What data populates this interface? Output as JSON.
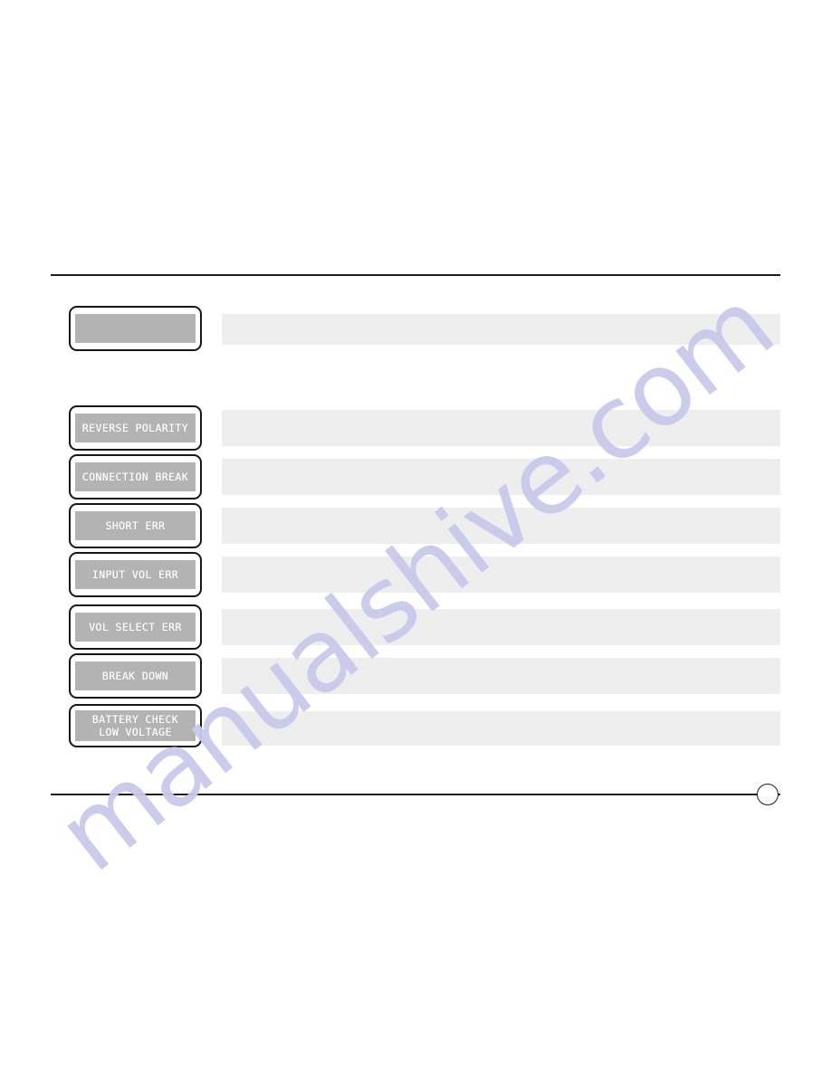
{
  "document": {
    "type": "product-manual-page",
    "watermark": "manualshive.com",
    "page_marker": ""
  },
  "colors": {
    "lcd_screen": "#b3b3b3",
    "lcd_text": "#ffffff",
    "lcd_bezel": "#171717",
    "redaction_bar": "#eeeeee",
    "rule": "#1c1c1c",
    "watermark": "#c9c9ea",
    "page_background": "#ffffff"
  },
  "table": {
    "header_row": {
      "display_lines": [
        ""
      ],
      "description": ""
    },
    "rows": [
      {
        "display_lines": [
          "REVERSE POLARITY"
        ],
        "description": ""
      },
      {
        "display_lines": [
          "CONNECTION BREAK"
        ],
        "description": ""
      },
      {
        "display_lines": [
          "SHORT ERR"
        ],
        "description": ""
      },
      {
        "display_lines": [
          "INPUT VOL ERR"
        ],
        "description": ""
      },
      {
        "display_lines": [
          "VOL SELECT ERR"
        ],
        "description": ""
      },
      {
        "display_lines": [
          "BREAK DOWN"
        ],
        "description": ""
      },
      {
        "display_lines": [
          "BATTERY CHECK",
          "LOW VOLTAGE"
        ],
        "description": ""
      }
    ]
  }
}
